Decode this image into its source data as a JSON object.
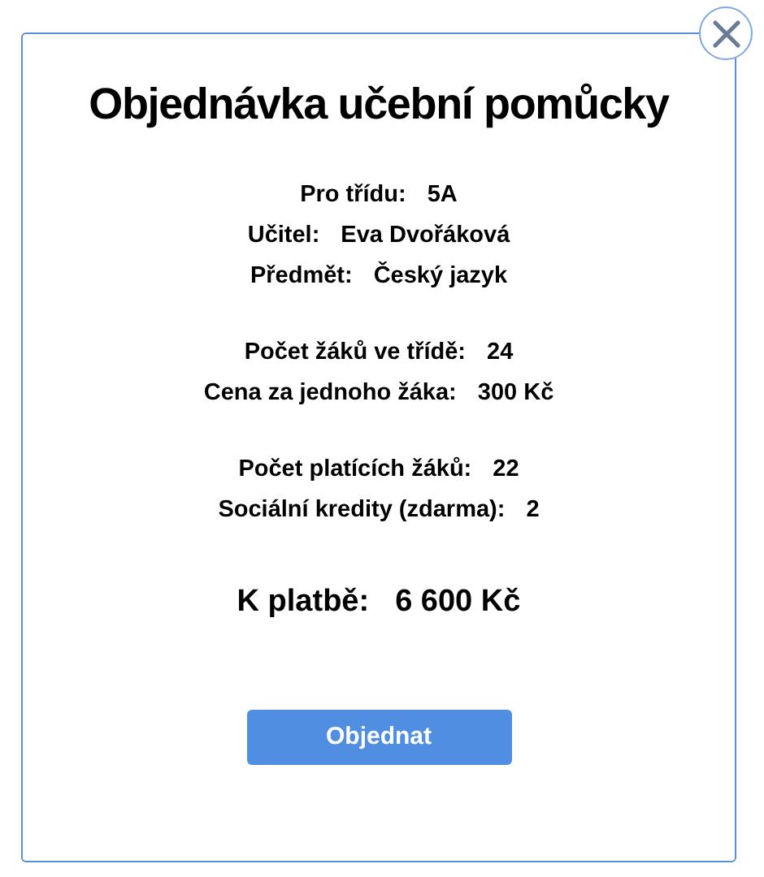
{
  "title": "Objednávka učební pomůcky",
  "groups": [
    {
      "rows": [
        {
          "label": "Pro třídu:",
          "value": "5A"
        },
        {
          "label": "Učitel:",
          "value": "Eva Dvořáková"
        },
        {
          "label": "Předmět:",
          "value": "Český jazyk"
        }
      ]
    },
    {
      "rows": [
        {
          "label": "Počet žáků ve třídě:",
          "value": "24"
        },
        {
          "label": "Cena za jednoho žáka:",
          "value": "300 Kč"
        }
      ]
    },
    {
      "rows": [
        {
          "label": "Počet platících žáků:",
          "value": "22"
        },
        {
          "label": "Sociální kredity (zdarma):",
          "value": "2"
        }
      ]
    }
  ],
  "total": {
    "label": "K platbě:",
    "value": "6 600 Kč"
  },
  "button": "Objednat"
}
